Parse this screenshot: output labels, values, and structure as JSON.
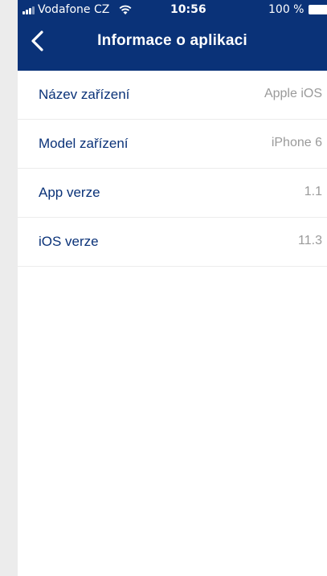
{
  "status_bar": {
    "carrier": "Vodafone CZ",
    "time": "10:56",
    "battery": "100 %"
  },
  "header": {
    "title": "Informace o aplikaci",
    "back_icon": "chevron-left-icon"
  },
  "info_rows": [
    {
      "label": "Název zařízení",
      "value": "Apple iOS"
    },
    {
      "label": "Model zařízení",
      "value": "iPhone 6"
    },
    {
      "label": "App verze",
      "value": "1.1"
    },
    {
      "label": "iOS verze",
      "value": "11.3"
    }
  ],
  "colors": {
    "header_bg": "#0a3278",
    "label": "#0a3278",
    "value": "#9a9a9a"
  }
}
